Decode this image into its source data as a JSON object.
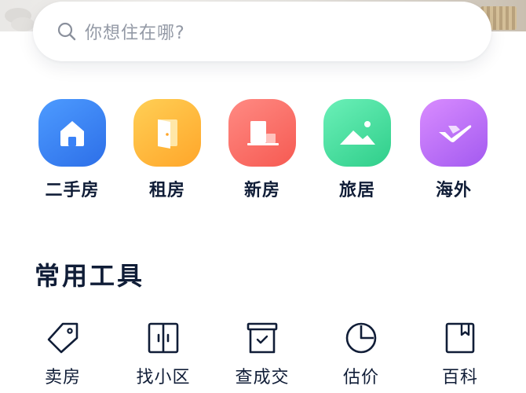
{
  "search": {
    "placeholder": "你想住在哪?"
  },
  "categories": [
    {
      "label": "二手房",
      "icon": "house-icon",
      "color": "#3a82f7"
    },
    {
      "label": "租房",
      "icon": "door-icon",
      "color": "#ffb735"
    },
    {
      "label": "新房",
      "icon": "building-icon",
      "color": "#f8665f"
    },
    {
      "label": "旅居",
      "icon": "landscape-icon",
      "color": "#3fdb98"
    },
    {
      "label": "海外",
      "icon": "airplane-icon",
      "color": "#b86cf5"
    }
  ],
  "tools_section": {
    "title": "常用工具",
    "items": [
      {
        "label": "卖房",
        "icon": "price-tag-icon"
      },
      {
        "label": "找小区",
        "icon": "double-door-icon"
      },
      {
        "label": "查成交",
        "icon": "archive-box-icon"
      },
      {
        "label": "估价",
        "icon": "pie-chart-icon"
      },
      {
        "label": "百科",
        "icon": "bookmark-book-icon"
      }
    ]
  },
  "colors": {
    "text_primary": "#101d37",
    "text_placeholder": "#9399a5"
  }
}
